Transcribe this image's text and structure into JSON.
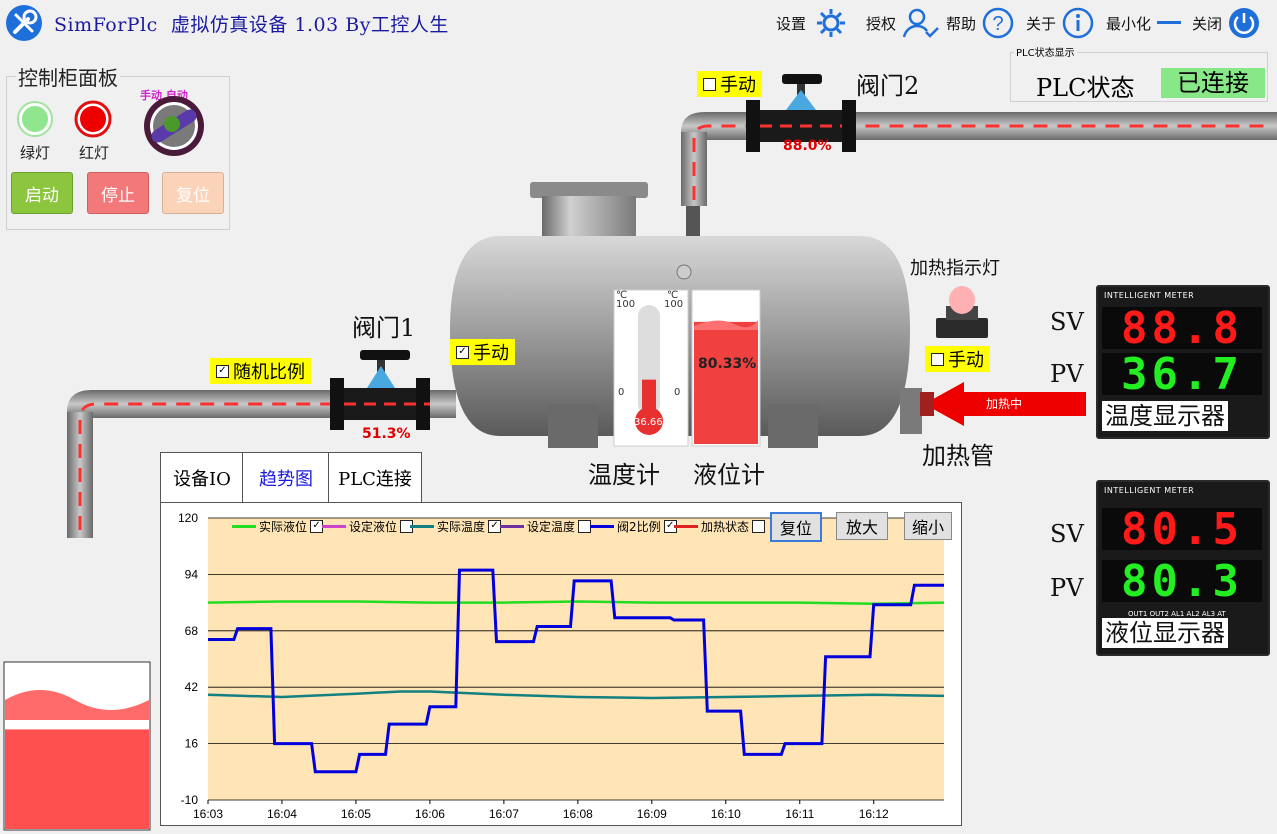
{
  "app": {
    "title": "SimForPlc  虚拟仿真设备 1.03 By工控人生",
    "menu": [
      {
        "label": "设置",
        "icon": "gear-icon"
      },
      {
        "label": "授权",
        "icon": "user-check-icon"
      },
      {
        "label": "帮助",
        "icon": "help-icon"
      },
      {
        "label": "关于",
        "icon": "info-icon"
      },
      {
        "label": "最小化",
        "icon": "minimize-icon"
      },
      {
        "label": "关闭",
        "icon": "power-icon"
      }
    ]
  },
  "control_panel": {
    "title": "控制柜面板",
    "green_lamp": "绿灯",
    "red_lamp": "红灯",
    "selector_manual": "手动",
    "selector_auto": "自动",
    "start": "启动",
    "stop": "停止",
    "reset": "复位"
  },
  "plc": {
    "group_title": "PLC状态显示",
    "label": "PLC状态",
    "status": "已连接"
  },
  "valve1": {
    "label": "阀门1",
    "mode": "手动",
    "mode_checked": true,
    "random": "随机比例",
    "random_checked": true,
    "open_pct": "51.3%"
  },
  "valve2": {
    "label": "阀门2",
    "mode": "手动",
    "mode_checked": false,
    "open_pct": "88.0%"
  },
  "heater": {
    "indicator_label": "加热指示灯",
    "mode": "手动",
    "mode_checked": false,
    "arrow_text": "加热中",
    "label": "加热管"
  },
  "thermometer": {
    "unit": "℃",
    "scale_max": "100",
    "scale_min": "0",
    "value": "36.66",
    "level_fraction": 0.367,
    "label": "温度计"
  },
  "level_gauge": {
    "value": "80.33%",
    "level_fraction": 0.8033,
    "label": "液位计"
  },
  "temp_meter": {
    "header": "INTELLIGENT   METER",
    "sv_label": "SV",
    "pv_label": "PV",
    "sv": "88.8",
    "pv": "36.7",
    "name": "温度显示器"
  },
  "level_meter": {
    "header": "INTELLIGENT   METER",
    "sv_label": "SV",
    "pv_label": "PV",
    "sv": "80.5",
    "pv": "80.3",
    "name": "液位显示器",
    "footer": "OUT1 OUT2 AL1 AL2 AL3 AT"
  },
  "bottom_tank": {
    "level_fraction": 0.6
  },
  "tabs": [
    {
      "label": "设备IO",
      "active": false
    },
    {
      "label": "趋势图",
      "active": true
    },
    {
      "label": "PLC连接",
      "active": false
    }
  ],
  "trend": {
    "legend": [
      {
        "name": "实际液位",
        "color": "#22dd22",
        "checked": true
      },
      {
        "name": "设定液位",
        "color": "#cc44cc",
        "checked": false
      },
      {
        "name": "实际温度",
        "color": "#128080",
        "checked": true
      },
      {
        "name": "设定温度",
        "color": "#7030a0",
        "checked": false
      },
      {
        "name": "阀2比例",
        "color": "#0000dd",
        "checked": true
      },
      {
        "name": "加热状态",
        "color": "#dd2222",
        "checked": false
      }
    ],
    "buttons": {
      "reset": "复位",
      "zoom_in": "放大",
      "zoom_out": "缩小"
    }
  },
  "chart_data": {
    "type": "line",
    "x_ticks": [
      "16:03",
      "16:04",
      "16:05",
      "16:06",
      "16:07",
      "16:08",
      "16:09",
      "16:10",
      "16:11",
      "16:12"
    ],
    "y_ticks": [
      "120",
      "94",
      "68",
      "42",
      "16",
      "-10"
    ],
    "ylim": [
      -10,
      120
    ],
    "xlim": [
      0,
      9.95
    ],
    "grid": true,
    "series": [
      {
        "name": "实际液位",
        "color": "#22dd22",
        "x": [
          0,
          1,
          2,
          3,
          4,
          5,
          6,
          7,
          8,
          9,
          9.95
        ],
        "y": [
          81,
          81.5,
          81.5,
          81,
          81,
          81.5,
          81,
          81,
          81,
          80.5,
          81
        ]
      },
      {
        "name": "实际温度",
        "color": "#128080",
        "x": [
          0,
          1,
          2,
          2.6,
          3,
          4,
          5,
          6,
          7,
          8,
          9,
          9.95
        ],
        "y": [
          38.5,
          37.5,
          39,
          40,
          40,
          38.5,
          37.5,
          37,
          37.5,
          38,
          38.5,
          38
        ]
      },
      {
        "name": "阀2比例",
        "color": "#0000dd",
        "x": [
          0,
          0.35,
          0.4,
          0.85,
          0.9,
          1.4,
          1.45,
          2,
          2.05,
          2.4,
          2.45,
          2.95,
          3,
          3.35,
          3.4,
          3.85,
          3.9,
          4.4,
          4.45,
          4.9,
          4.95,
          5.45,
          5.5,
          6.25,
          6.3,
          6.7,
          6.75,
          7.2,
          7.25,
          7.75,
          7.8,
          8.3,
          8.35,
          8.95,
          9,
          9.5,
          9.55,
          9.95
        ],
        "y": [
          64,
          64,
          69,
          69,
          16,
          16,
          3,
          3,
          11,
          11,
          25,
          25,
          33,
          33,
          96,
          96,
          63,
          63,
          70,
          70,
          91,
          91,
          74,
          74,
          73,
          73,
          31,
          31,
          11,
          11,
          16,
          16,
          56,
          56,
          80,
          80,
          89,
          89
        ]
      }
    ]
  }
}
